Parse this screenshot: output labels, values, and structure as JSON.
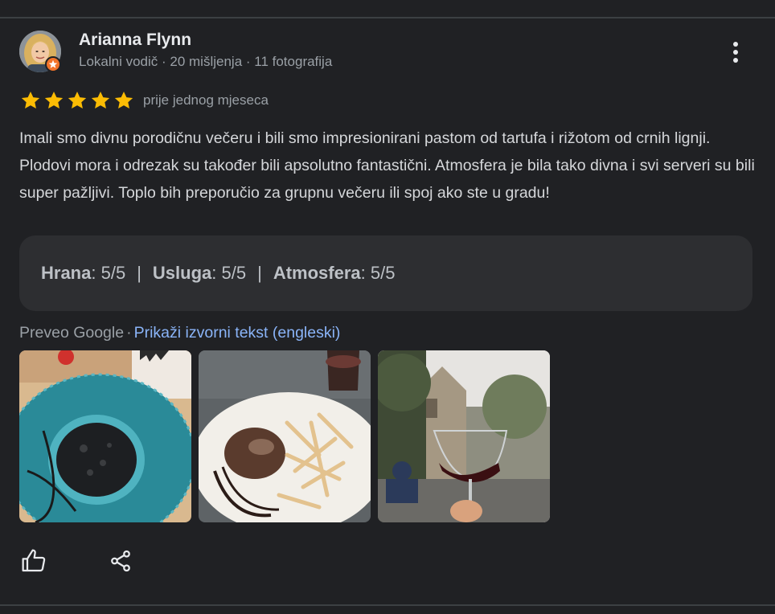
{
  "reviewer": {
    "name": "Arianna Flynn",
    "meta": "Lokalni vodič · 20 mišljenja · 11 fotografija",
    "badge_color": "#f2732a"
  },
  "rating": {
    "stars": 5,
    "max_stars": 5,
    "star_color": "#fbbc04",
    "date": "prije jednog mjeseca"
  },
  "review_text": "Imali smo divnu porodičnu večeru i bili smo impresionirani pastom od tartufa i rižotom od crnih lignji. Plodovi mora i odrezak su također bili apsolutno fantastični. Atmosfera je bila tako divna i svi serveri su bili super pažljivi. Toplo bih preporučio za grupnu večeru ili spoj ako ste u gradu!",
  "aspect_ratings": [
    {
      "name": "Hrana",
      "value": "5/5"
    },
    {
      "name": "Usluga",
      "value": "5/5"
    },
    {
      "name": "Atmosfera",
      "value": "5/5"
    }
  ],
  "separator": "|",
  "translation": {
    "translated_by": "Preveo Google",
    "dot": "·",
    "show_original": "Prikaži izvorni tekst (engleski)",
    "link_color": "#8ab4f8"
  },
  "photos": [
    {
      "subject": "black squid ink risotto on teal plate"
    },
    {
      "subject": "steak with truffle pasta on white plate"
    },
    {
      "subject": "glass of red wine on terrace with stone church"
    }
  ],
  "actions": {
    "like_icon": "thumb-up-icon",
    "share_icon": "share-icon"
  },
  "colors": {
    "background": "#202124",
    "panel": "#2d2e31",
    "text_primary": "#e8eaed",
    "text_secondary": "#9aa0a6"
  }
}
